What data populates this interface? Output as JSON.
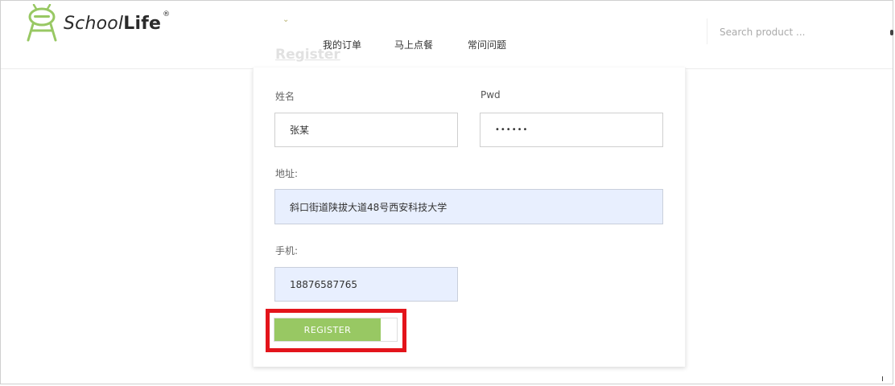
{
  "brand": {
    "name_a": "School",
    "name_b": "Life",
    "registered": "®",
    "accent_color": "#98c863"
  },
  "header": {
    "dropdown_icon": "chevron-down-icon",
    "nav": [
      "我的订单",
      "马上点餐",
      "常问问题"
    ],
    "search": {
      "placeholder": "Search product ..."
    }
  },
  "form": {
    "title": "Register",
    "fields": {
      "name": {
        "label": "姓名",
        "value": "张某"
      },
      "pwd": {
        "label": "Pwd",
        "value": "••••••"
      },
      "address": {
        "label": "地址:",
        "value": "斜口街道陕拔大道48号西安科技大学"
      },
      "phone": {
        "label": "手机:",
        "value": "18876587765"
      }
    },
    "submit_label": "REGISTER",
    "highlight_color": "#e3141b"
  }
}
